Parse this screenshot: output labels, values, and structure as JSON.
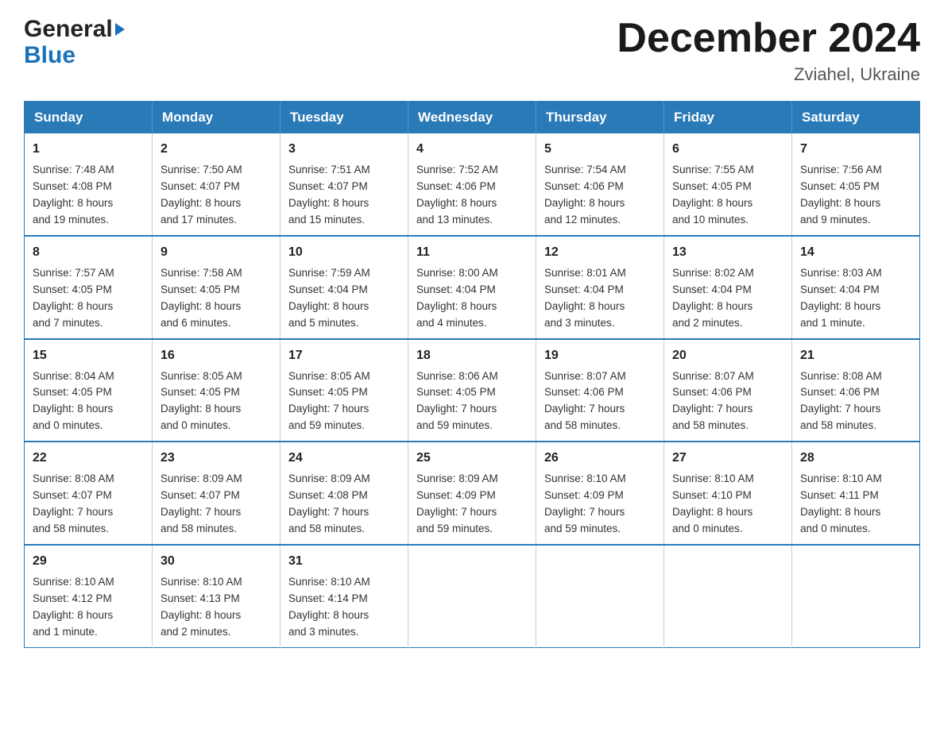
{
  "header": {
    "logo_general": "General",
    "logo_blue": "Blue",
    "title": "December 2024",
    "subtitle": "Zviahel, Ukraine"
  },
  "calendar": {
    "days_of_week": [
      "Sunday",
      "Monday",
      "Tuesday",
      "Wednesday",
      "Thursday",
      "Friday",
      "Saturday"
    ],
    "weeks": [
      [
        {
          "day": "1",
          "info": "Sunrise: 7:48 AM\nSunset: 4:08 PM\nDaylight: 8 hours\nand 19 minutes."
        },
        {
          "day": "2",
          "info": "Sunrise: 7:50 AM\nSunset: 4:07 PM\nDaylight: 8 hours\nand 17 minutes."
        },
        {
          "day": "3",
          "info": "Sunrise: 7:51 AM\nSunset: 4:07 PM\nDaylight: 8 hours\nand 15 minutes."
        },
        {
          "day": "4",
          "info": "Sunrise: 7:52 AM\nSunset: 4:06 PM\nDaylight: 8 hours\nand 13 minutes."
        },
        {
          "day": "5",
          "info": "Sunrise: 7:54 AM\nSunset: 4:06 PM\nDaylight: 8 hours\nand 12 minutes."
        },
        {
          "day": "6",
          "info": "Sunrise: 7:55 AM\nSunset: 4:05 PM\nDaylight: 8 hours\nand 10 minutes."
        },
        {
          "day": "7",
          "info": "Sunrise: 7:56 AM\nSunset: 4:05 PM\nDaylight: 8 hours\nand 9 minutes."
        }
      ],
      [
        {
          "day": "8",
          "info": "Sunrise: 7:57 AM\nSunset: 4:05 PM\nDaylight: 8 hours\nand 7 minutes."
        },
        {
          "day": "9",
          "info": "Sunrise: 7:58 AM\nSunset: 4:05 PM\nDaylight: 8 hours\nand 6 minutes."
        },
        {
          "day": "10",
          "info": "Sunrise: 7:59 AM\nSunset: 4:04 PM\nDaylight: 8 hours\nand 5 minutes."
        },
        {
          "day": "11",
          "info": "Sunrise: 8:00 AM\nSunset: 4:04 PM\nDaylight: 8 hours\nand 4 minutes."
        },
        {
          "day": "12",
          "info": "Sunrise: 8:01 AM\nSunset: 4:04 PM\nDaylight: 8 hours\nand 3 minutes."
        },
        {
          "day": "13",
          "info": "Sunrise: 8:02 AM\nSunset: 4:04 PM\nDaylight: 8 hours\nand 2 minutes."
        },
        {
          "day": "14",
          "info": "Sunrise: 8:03 AM\nSunset: 4:04 PM\nDaylight: 8 hours\nand 1 minute."
        }
      ],
      [
        {
          "day": "15",
          "info": "Sunrise: 8:04 AM\nSunset: 4:05 PM\nDaylight: 8 hours\nand 0 minutes."
        },
        {
          "day": "16",
          "info": "Sunrise: 8:05 AM\nSunset: 4:05 PM\nDaylight: 8 hours\nand 0 minutes."
        },
        {
          "day": "17",
          "info": "Sunrise: 8:05 AM\nSunset: 4:05 PM\nDaylight: 7 hours\nand 59 minutes."
        },
        {
          "day": "18",
          "info": "Sunrise: 8:06 AM\nSunset: 4:05 PM\nDaylight: 7 hours\nand 59 minutes."
        },
        {
          "day": "19",
          "info": "Sunrise: 8:07 AM\nSunset: 4:06 PM\nDaylight: 7 hours\nand 58 minutes."
        },
        {
          "day": "20",
          "info": "Sunrise: 8:07 AM\nSunset: 4:06 PM\nDaylight: 7 hours\nand 58 minutes."
        },
        {
          "day": "21",
          "info": "Sunrise: 8:08 AM\nSunset: 4:06 PM\nDaylight: 7 hours\nand 58 minutes."
        }
      ],
      [
        {
          "day": "22",
          "info": "Sunrise: 8:08 AM\nSunset: 4:07 PM\nDaylight: 7 hours\nand 58 minutes."
        },
        {
          "day": "23",
          "info": "Sunrise: 8:09 AM\nSunset: 4:07 PM\nDaylight: 7 hours\nand 58 minutes."
        },
        {
          "day": "24",
          "info": "Sunrise: 8:09 AM\nSunset: 4:08 PM\nDaylight: 7 hours\nand 58 minutes."
        },
        {
          "day": "25",
          "info": "Sunrise: 8:09 AM\nSunset: 4:09 PM\nDaylight: 7 hours\nand 59 minutes."
        },
        {
          "day": "26",
          "info": "Sunrise: 8:10 AM\nSunset: 4:09 PM\nDaylight: 7 hours\nand 59 minutes."
        },
        {
          "day": "27",
          "info": "Sunrise: 8:10 AM\nSunset: 4:10 PM\nDaylight: 8 hours\nand 0 minutes."
        },
        {
          "day": "28",
          "info": "Sunrise: 8:10 AM\nSunset: 4:11 PM\nDaylight: 8 hours\nand 0 minutes."
        }
      ],
      [
        {
          "day": "29",
          "info": "Sunrise: 8:10 AM\nSunset: 4:12 PM\nDaylight: 8 hours\nand 1 minute."
        },
        {
          "day": "30",
          "info": "Sunrise: 8:10 AM\nSunset: 4:13 PM\nDaylight: 8 hours\nand 2 minutes."
        },
        {
          "day": "31",
          "info": "Sunrise: 8:10 AM\nSunset: 4:14 PM\nDaylight: 8 hours\nand 3 minutes."
        },
        {
          "day": "",
          "info": ""
        },
        {
          "day": "",
          "info": ""
        },
        {
          "day": "",
          "info": ""
        },
        {
          "day": "",
          "info": ""
        }
      ]
    ]
  }
}
